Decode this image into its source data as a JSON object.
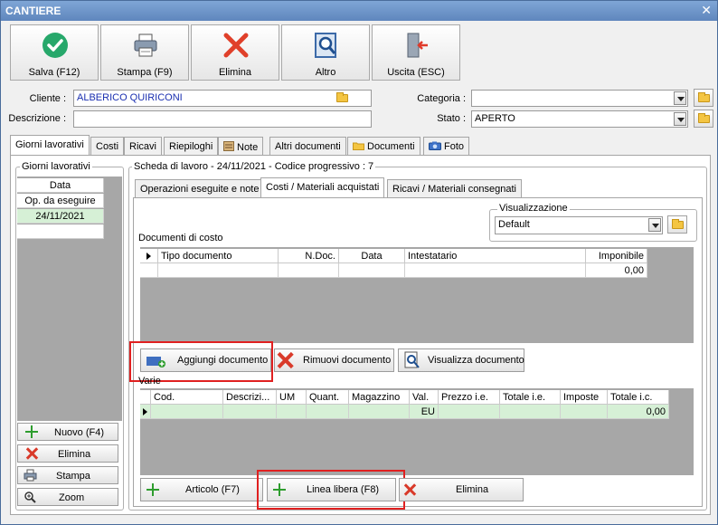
{
  "window": {
    "title": "CANTIERE",
    "close_glyph": "✕"
  },
  "toolbar": {
    "save_label": "Salva (F12)",
    "print_label": "Stampa (F9)",
    "delete_label": "Elimina",
    "other_label": "Altro",
    "exit_label": "Uscita (ESC)"
  },
  "form": {
    "cliente_label": "Cliente :",
    "cliente_value": "ALBERICO QUIRICONI",
    "descrizione_label": "Descrizione :",
    "descrizione_value": "",
    "categoria_label": "Categoria :",
    "categoria_value": "",
    "stato_label": "Stato :",
    "stato_value": "APERTO"
  },
  "tabs": [
    {
      "label": "Giorni lavorativi"
    },
    {
      "label": "Costi"
    },
    {
      "label": "Ricavi"
    },
    {
      "label": "Riepiloghi"
    },
    {
      "label": "Note"
    },
    {
      "label": "Altri documenti"
    },
    {
      "label": "Documenti"
    },
    {
      "label": "Foto"
    }
  ],
  "giorni": {
    "group_title": "Giorni lavorativi",
    "column": "Data",
    "rows": [
      "Op. da eseguire",
      "24/11/2021"
    ],
    "buttons": {
      "new": "Nuovo (F4)",
      "delete": "Elimina",
      "print": "Stampa",
      "zoom": "Zoom"
    }
  },
  "scheda": {
    "title": "Scheda di lavoro - 24/11/2021 - Codice progressivo : 7",
    "subtabs": [
      {
        "label": "Operazioni eseguite e note"
      },
      {
        "label": "Costi / Materiali acquistati"
      },
      {
        "label": "Ricavi / Materiali consegnati"
      }
    ],
    "visualizzazione_title": "Visualizzazione",
    "visualizzazione_value": "Default"
  },
  "documenti": {
    "label": "Documenti di costo",
    "columns": [
      "Tipo documento",
      "N.Doc.",
      "Data",
      "Intestatario",
      "Imponibile"
    ],
    "row": [
      "",
      "",
      "",
      "",
      "0,00"
    ],
    "buttons": {
      "add": "Aggiungi documento",
      "remove": "Rimuovi documento",
      "view": "Visualizza documento"
    }
  },
  "varie": {
    "label": "Varie",
    "columns": [
      "Cod.",
      "Descrizi...",
      "UM",
      "Quant.",
      "Magazzino",
      "Val.",
      "Prezzo i.e.",
      "Totale i.e.",
      "Imposte",
      "Totale i.c."
    ],
    "row": [
      "",
      "",
      "",
      "",
      "",
      "EU",
      "",
      "",
      "",
      "0,00"
    ],
    "buttons": {
      "articolo": "Articolo (F7)",
      "linea": "Linea libera (F8)",
      "delete": "Elimina"
    }
  },
  "colors": {
    "accent": "#5f86bd",
    "highlight": "#e02020",
    "row_green": "#d6f0d6"
  }
}
